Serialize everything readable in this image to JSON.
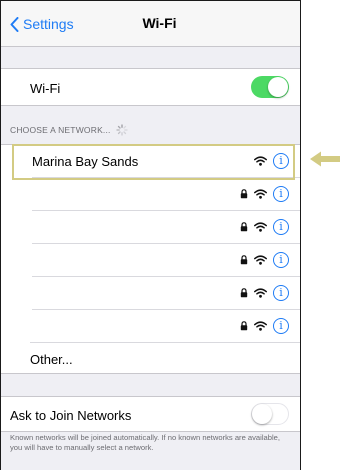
{
  "navbar": {
    "back_label": "Settings",
    "title": "Wi-Fi"
  },
  "wifi_row": {
    "label": "Wi-Fi",
    "toggle_on": true
  },
  "networks_section": {
    "header": "CHOOSE A NETWORK...",
    "networks": [
      {
        "name": "Marina Bay Sands",
        "locked": false
      },
      {
        "name": "",
        "locked": true
      },
      {
        "name": "",
        "locked": true
      },
      {
        "name": "",
        "locked": true
      },
      {
        "name": "",
        "locked": true
      },
      {
        "name": "",
        "locked": true
      }
    ],
    "info_glyph": "i",
    "other_label": "Other..."
  },
  "ask_join": {
    "label": "Ask to Join Networks",
    "toggle_on": false,
    "description": "Known networks will be joined automatically. If no known networks are available, you will have to manually select a network."
  },
  "colors": {
    "accent": "#1f7cf5",
    "toggle_on": "#4cd964",
    "highlight": "#d3cb83"
  },
  "icons": {
    "back": "chevron-left-icon",
    "wifi": "wifi-icon",
    "lock": "lock-icon",
    "info": "info-icon",
    "spinner": "loading-spinner-icon",
    "arrow": "arrow-left-icon"
  }
}
